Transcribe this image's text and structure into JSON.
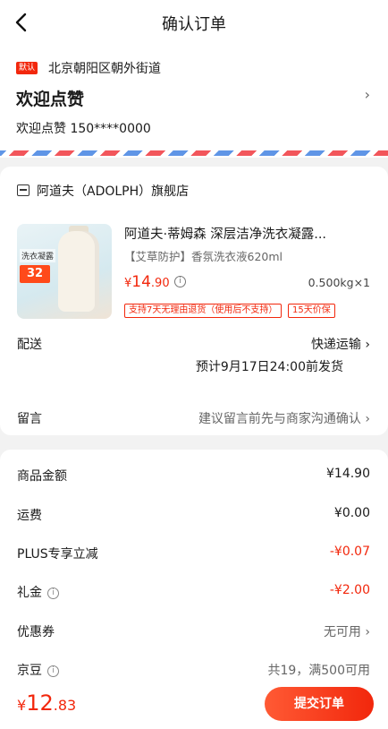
{
  "header": {
    "title": "确认订单"
  },
  "address": {
    "tag": "默认",
    "region": "北京朝阳区朝外街道",
    "name": "欢迎点赞",
    "contact": "欢迎点赞  150****0000"
  },
  "store": {
    "name": "阿道夫（ADOLPH）旗舰店"
  },
  "product": {
    "title": "阿道夫·蒂姆森 深层洁净洗衣凝露...",
    "spec": "【艾草防护】香氛洗衣液620ml",
    "price_symbol": "¥",
    "price_int": "14",
    "price_dec": ".90",
    "qty": "0.500kg×1",
    "thumb_label": "洗衣凝露",
    "thumb_price": "32",
    "services": [
      "支持7天无理由退货（使用后不支持）",
      "15天价保"
    ]
  },
  "delivery": {
    "label": "配送",
    "method": "快递运输",
    "eta": "预计9月17日24:00前发货"
  },
  "message": {
    "label": "留言",
    "placeholder": "建议留言前先与商家沟通确认"
  },
  "summary": {
    "goods_label": "商品金额",
    "goods_value": "¥14.90",
    "shipping_label": "运费",
    "shipping_value": "¥0.00",
    "plus_label": "PLUS专享立减",
    "plus_value": "-¥0.07",
    "gift_label": "礼金",
    "gift_value": "-¥2.00",
    "coupon_label": "优惠券",
    "coupon_value": "无可用",
    "jd_label": "京豆",
    "jd_value": "共19，满500可用"
  },
  "footer": {
    "symbol": "¥",
    "amount_int": "12",
    "amount_dec": ".83",
    "submit": "提交订单"
  },
  "colors": {
    "accent": "#f2270c"
  }
}
